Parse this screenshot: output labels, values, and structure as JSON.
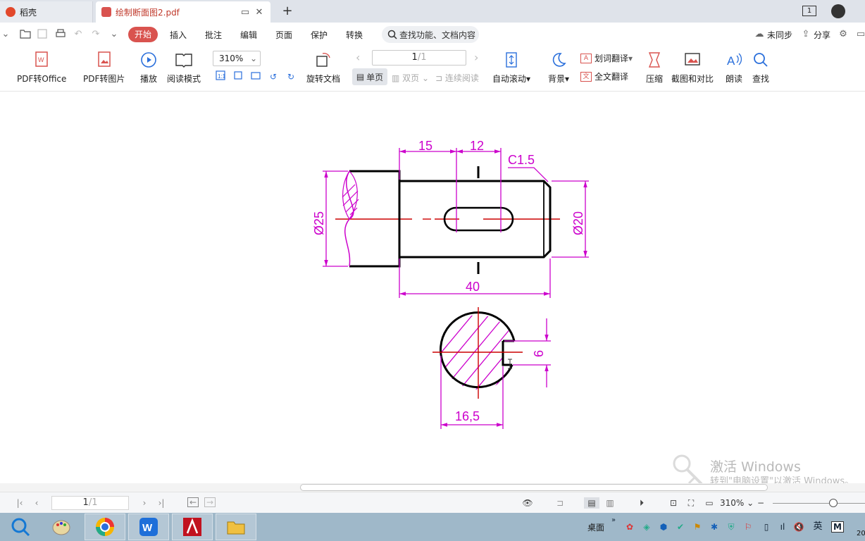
{
  "tabs": [
    {
      "label": "稻壳",
      "active": false
    },
    {
      "label": "绘制断面图2.pdf",
      "active": true
    }
  ],
  "titlebar": {
    "window_count": "1"
  },
  "menu": {
    "items": [
      "开始",
      "插入",
      "批注",
      "编辑",
      "页面",
      "保护",
      "转换"
    ],
    "search_placeholder": "查找功能、文档内容",
    "sync": "未同步",
    "share": "分享"
  },
  "toolbar": {
    "pdf_to_office": "PDF转Office",
    "pdf_to_image": "PDF转图片",
    "play": "播放",
    "read_mode": "阅读模式",
    "zoom": "310%",
    "rotate": "旋转文档",
    "page_current": "1",
    "page_total": "/1",
    "view_single": "单页",
    "view_double": "双页",
    "view_continuous": "连续阅读",
    "auto_scroll": "自动滚动",
    "background": "背景",
    "word_translate": "划词翻译",
    "full_translate": "全文翻译",
    "compress": "压缩",
    "screenshot_compare": "截图和对比",
    "read_aloud": "朗读",
    "find": "查找"
  },
  "drawing": {
    "dim_15": "15",
    "dim_12": "12",
    "chamfer": "C1.5",
    "dia_25": "Ø25",
    "dia_20": "Ø20",
    "dim_40": "40",
    "dim_6": "6",
    "dim_16_5": "16,5",
    "colors": {
      "outline": "#000000",
      "dimension": "#cc00cc",
      "centerline": "#cc0000",
      "hatch": "#cc00cc"
    }
  },
  "watermark": {
    "title": "激活 Windows",
    "subtitle": "转到\"电脑设置\"以激活 Windows。"
  },
  "statusbar": {
    "page_current": "1",
    "page_total": "/1",
    "zoom": "310%"
  },
  "taskbar": {
    "desktop": "桌面",
    "ime": "英",
    "ime_mode": "M",
    "clock_fragment": "20"
  }
}
